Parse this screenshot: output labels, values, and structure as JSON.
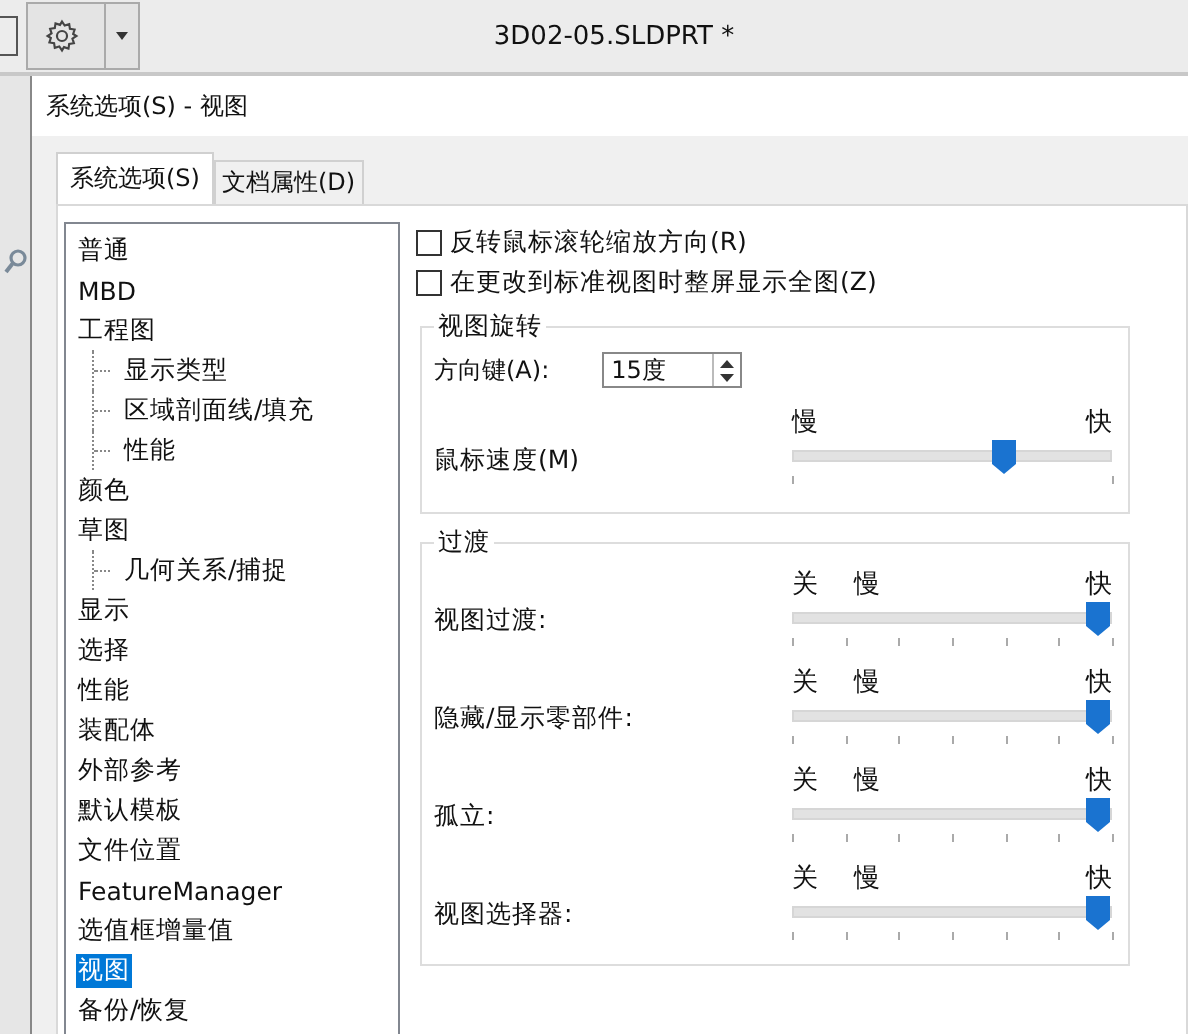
{
  "window": {
    "title": "3D02-05.SLDPRT *"
  },
  "dialog": {
    "title": "系统选项(S) - 视图"
  },
  "tabs": [
    {
      "label": "系统选项(S)",
      "selected": true
    },
    {
      "label": "文档属性(D)",
      "selected": false
    }
  ],
  "tree": [
    {
      "label": "普通",
      "selected": false
    },
    {
      "label": "MBD",
      "selected": false
    },
    {
      "label": "工程图",
      "selected": false,
      "children": [
        {
          "label": "显示类型",
          "selected": false
        },
        {
          "label": "区域剖面线/填充",
          "selected": false
        },
        {
          "label": "性能",
          "selected": false
        }
      ]
    },
    {
      "label": "颜色",
      "selected": false
    },
    {
      "label": "草图",
      "selected": false,
      "children": [
        {
          "label": "几何关系/捕捉",
          "selected": false
        }
      ]
    },
    {
      "label": "显示",
      "selected": false
    },
    {
      "label": "选择",
      "selected": false
    },
    {
      "label": "性能",
      "selected": false
    },
    {
      "label": "装配体",
      "selected": false
    },
    {
      "label": "外部参考",
      "selected": false
    },
    {
      "label": "默认模板",
      "selected": false
    },
    {
      "label": "文件位置",
      "selected": false
    },
    {
      "label": "FeatureManager",
      "selected": false
    },
    {
      "label": "选值框增量值",
      "selected": false
    },
    {
      "label": "视图",
      "selected": true
    },
    {
      "label": "备份/恢复",
      "selected": false
    }
  ],
  "checkboxes": [
    {
      "label": "反转鼠标滚轮缩放方向(R)",
      "checked": false
    },
    {
      "label": "在更改到标准视图时整屏显示全图(Z)",
      "checked": false
    }
  ],
  "view_rotation": {
    "title": "视图旋转",
    "arrow_keys": {
      "label": "方向键(A):",
      "value": "15度"
    },
    "mouse_speed": {
      "label": "鼠标速度(M)",
      "scale_labels": [
        "慢",
        "快"
      ],
      "level": 0.7
    }
  },
  "transitions": {
    "title": "过渡",
    "sliders": [
      {
        "label": "视图过渡:",
        "scale_labels": [
          "关",
          "慢",
          "快"
        ],
        "level": 1
      },
      {
        "label": "隐藏/显示零部件:",
        "scale_labels": [
          "关",
          "慢",
          "快"
        ],
        "level": 1
      },
      {
        "label": "孤立:",
        "scale_labels": [
          "关",
          "慢",
          "快"
        ],
        "level": 1
      },
      {
        "label": "视图选择器:",
        "scale_labels": [
          "关",
          "慢",
          "快"
        ],
        "level": 1
      }
    ]
  }
}
